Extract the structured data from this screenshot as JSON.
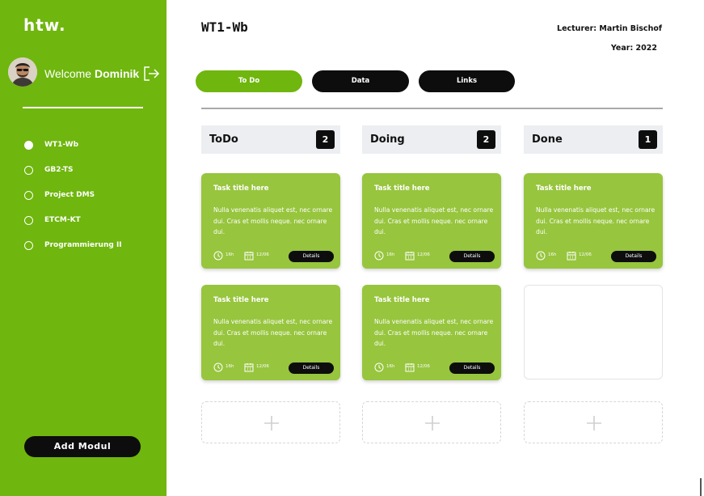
{
  "sidebar": {
    "logo": "htw.",
    "welcome_prefix": "Welcome",
    "user_name": "Dominik",
    "items": [
      {
        "label": "WT1-Wb",
        "active": true
      },
      {
        "label": "GB2-TS",
        "active": false
      },
      {
        "label": "Project DMS",
        "active": false
      },
      {
        "label": "ETCM-KT",
        "active": false
      },
      {
        "label": "Programmierung II",
        "active": false
      }
    ],
    "add_button": "Add Modul"
  },
  "header": {
    "title": "WT1-Wb",
    "lecturer": "Lecturer: Martin Bischof",
    "year": "Year: 2022"
  },
  "tabs": [
    "To Do",
    "Data",
    "Links"
  ],
  "columns": [
    {
      "name": "ToDo",
      "count": "2",
      "cards": [
        {
          "title": "Task title here",
          "description": "Nulla venenatis aliquet est, nec ornare dui. Cras et mollis neque. nec ornare dui.",
          "hours": "16h",
          "date": "12/06",
          "details": "Details"
        },
        {
          "title": "Task title here",
          "description": "Nulla venenatis aliquet est, nec ornare dui. Cras et mollis neque. nec ornare dui.",
          "hours": "16h",
          "date": "12/06",
          "details": "Details"
        }
      ]
    },
    {
      "name": "Doing",
      "count": "2",
      "cards": [
        {
          "title": "Task title here",
          "description": "Nulla venenatis aliquet est, nec ornare dui. Cras et mollis neque. nec ornare dui.",
          "hours": "16h",
          "date": "12/06",
          "details": "Details"
        },
        {
          "title": "Task title here",
          "description": "Nulla venenatis aliquet est, nec ornare dui. Cras et mollis neque. nec ornare dui.",
          "hours": "16h",
          "date": "12/06",
          "details": "Details"
        }
      ]
    },
    {
      "name": "Done",
      "count": "1",
      "cards": [
        {
          "title": "Task title here",
          "description": "Nulla venenatis aliquet est, nec ornare dui. Cras et mollis neque. nec ornare dui.",
          "hours": "16h",
          "date": "12/06",
          "details": "Details"
        }
      ]
    }
  ],
  "colors": {
    "brand_green": "#6fb60e",
    "card_green": "#97c53e",
    "dark": "#0d0d0d",
    "column_header_bg": "#eceef1"
  },
  "icons": {
    "logout": "logout-icon",
    "clock": "clock-icon",
    "calendar": "calendar-icon",
    "add": "plus-icon"
  }
}
